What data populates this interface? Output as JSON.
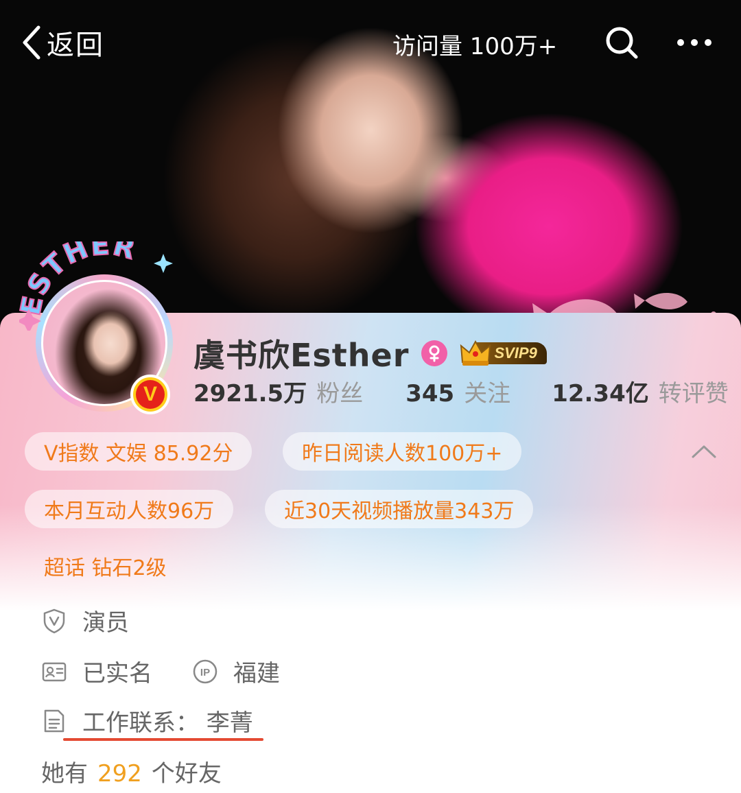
{
  "nav": {
    "back_label": "返回",
    "visits_label": "访问量 100万+",
    "search_icon": "search-icon",
    "more_icon": "more-horizontal-icon"
  },
  "banner": {
    "avatar_frame_text": "ESTHER"
  },
  "profile": {
    "name": "虞书欣Esther",
    "gender_icon": "female-icon",
    "svip_label": "SVIP9",
    "verified_badge": "V",
    "stats": [
      {
        "value": "2921.5万",
        "label": "粉丝"
      },
      {
        "value": "345",
        "label": "关注"
      },
      {
        "value": "12.34亿",
        "label": "转评赞"
      }
    ]
  },
  "chips": [
    {
      "text": "V指数 文娱 85.92分"
    },
    {
      "text": "昨日阅读人数100万+"
    },
    {
      "text": "本月互动人数96万"
    },
    {
      "text": "近30天视频播放量343万"
    },
    {
      "text": "超话 钻石2级"
    }
  ],
  "info": {
    "occupation": "演员",
    "verified_name": "已实名",
    "ip_location": "福建",
    "work_contact": "工作联系：  李菁"
  },
  "friends": {
    "prefix": "她有",
    "count": "292",
    "suffix": "个好友"
  },
  "colors": {
    "accent_orange": "#f07a1a",
    "friend_count": "#f0a020",
    "underline_red": "#e44a32",
    "gender_pink": "#f160a8"
  }
}
